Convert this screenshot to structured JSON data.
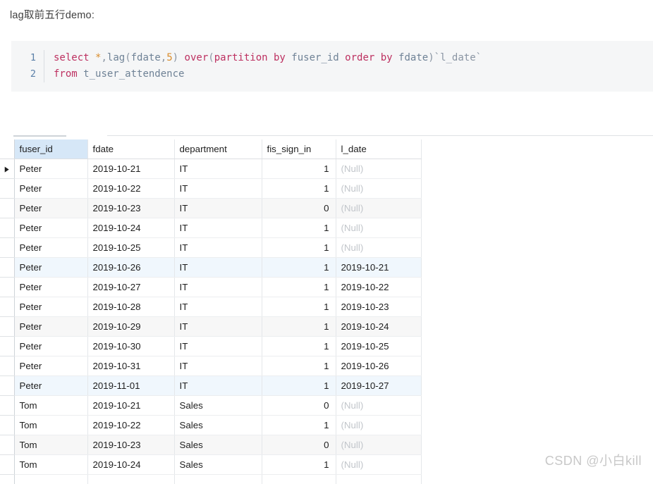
{
  "page": {
    "title": "lag取前五行demo:",
    "watermark": "CSDN @小白kill"
  },
  "code": {
    "language": "sql",
    "line_numbers": [
      "1",
      "2"
    ],
    "lines": [
      "select *,lag(fdate,5) over(partition by fuser_id order by fdate)`l_date`",
      "from t_user_attendence"
    ],
    "tokens_line1": {
      "select": "select",
      "sp1": " ",
      "star": "*",
      "comma1": ",",
      "lag": "lag",
      "paren_open1": "(",
      "fdate1": "fdate",
      "comma2": ",",
      "five": "5",
      "paren_close1": ")",
      "sp2": " ",
      "over": "over",
      "paren_open2": "(",
      "partition": "partition",
      "sp3": " ",
      "by1": "by",
      "sp4": " ",
      "fuser_id": "fuser_id",
      "sp5": " ",
      "order": "order",
      "sp6": " ",
      "by2": "by",
      "sp7": " ",
      "fdate2": "fdate",
      "paren_close2": ")",
      "alias": "`l_date`"
    },
    "tokens_line2": {
      "from": "from",
      "sp1": " ",
      "table": "t_user_attendence"
    },
    "colors": {
      "background": "#f5f6f7",
      "keyword": "#bd3060",
      "identifier": "#6f8296",
      "number": "#d98c2b",
      "operator": "#8a95a3",
      "line_number": "#5a7fa8"
    }
  },
  "result_grid": {
    "row_marker_glyph": "►",
    "current_row_index": 0,
    "highlighted_header": "fuser_id",
    "null_label": "(Null)",
    "columns": [
      {
        "key": "fuser_id",
        "label": "fuser_id",
        "align": "left"
      },
      {
        "key": "fdate",
        "label": "fdate",
        "align": "left"
      },
      {
        "key": "department",
        "label": "department",
        "align": "left"
      },
      {
        "key": "fis_sign_in",
        "label": "fis_sign_in",
        "align": "right"
      },
      {
        "key": "l_date",
        "label": "l_date",
        "align": "left"
      }
    ],
    "rows": [
      {
        "fuser_id": "Peter",
        "fdate": "2019-10-21",
        "department": "IT",
        "fis_sign_in": "1",
        "l_date": "(Null)",
        "l_date_is_null": true,
        "band": "none"
      },
      {
        "fuser_id": "Peter",
        "fdate": "2019-10-22",
        "department": "IT",
        "fis_sign_in": "1",
        "l_date": "(Null)",
        "l_date_is_null": true,
        "band": "none"
      },
      {
        "fuser_id": "Peter",
        "fdate": "2019-10-23",
        "department": "IT",
        "fis_sign_in": "0",
        "l_date": "(Null)",
        "l_date_is_null": true,
        "band": "grey"
      },
      {
        "fuser_id": "Peter",
        "fdate": "2019-10-24",
        "department": "IT",
        "fis_sign_in": "1",
        "l_date": "(Null)",
        "l_date_is_null": true,
        "band": "none"
      },
      {
        "fuser_id": "Peter",
        "fdate": "2019-10-25",
        "department": "IT",
        "fis_sign_in": "1",
        "l_date": "(Null)",
        "l_date_is_null": true,
        "band": "none"
      },
      {
        "fuser_id": "Peter",
        "fdate": "2019-10-26",
        "department": "IT",
        "fis_sign_in": "1",
        "l_date": "2019-10-21",
        "l_date_is_null": false,
        "band": "blue"
      },
      {
        "fuser_id": "Peter",
        "fdate": "2019-10-27",
        "department": "IT",
        "fis_sign_in": "1",
        "l_date": "2019-10-22",
        "l_date_is_null": false,
        "band": "none"
      },
      {
        "fuser_id": "Peter",
        "fdate": "2019-10-28",
        "department": "IT",
        "fis_sign_in": "1",
        "l_date": "2019-10-23",
        "l_date_is_null": false,
        "band": "none"
      },
      {
        "fuser_id": "Peter",
        "fdate": "2019-10-29",
        "department": "IT",
        "fis_sign_in": "1",
        "l_date": "2019-10-24",
        "l_date_is_null": false,
        "band": "grey"
      },
      {
        "fuser_id": "Peter",
        "fdate": "2019-10-30",
        "department": "IT",
        "fis_sign_in": "1",
        "l_date": "2019-10-25",
        "l_date_is_null": false,
        "band": "none"
      },
      {
        "fuser_id": "Peter",
        "fdate": "2019-10-31",
        "department": "IT",
        "fis_sign_in": "1",
        "l_date": "2019-10-26",
        "l_date_is_null": false,
        "band": "none"
      },
      {
        "fuser_id": "Peter",
        "fdate": "2019-11-01",
        "department": "IT",
        "fis_sign_in": "1",
        "l_date": "2019-10-27",
        "l_date_is_null": false,
        "band": "blue"
      },
      {
        "fuser_id": "Tom",
        "fdate": "2019-10-21",
        "department": "Sales",
        "fis_sign_in": "0",
        "l_date": "(Null)",
        "l_date_is_null": true,
        "band": "none"
      },
      {
        "fuser_id": "Tom",
        "fdate": "2019-10-22",
        "department": "Sales",
        "fis_sign_in": "1",
        "l_date": "(Null)",
        "l_date_is_null": true,
        "band": "none"
      },
      {
        "fuser_id": "Tom",
        "fdate": "2019-10-23",
        "department": "Sales",
        "fis_sign_in": "0",
        "l_date": "(Null)",
        "l_date_is_null": true,
        "band": "grey"
      },
      {
        "fuser_id": "Tom",
        "fdate": "2019-10-24",
        "department": "Sales",
        "fis_sign_in": "1",
        "l_date": "(Null)",
        "l_date_is_null": true,
        "band": "none"
      }
    ],
    "colors": {
      "header_highlight": "#d6e7f7",
      "band_grey": "#f7f7f7",
      "band_blue": "#f0f7fd",
      "null_text": "#c2c6cb",
      "grid_line": "#e4e7ea"
    }
  }
}
